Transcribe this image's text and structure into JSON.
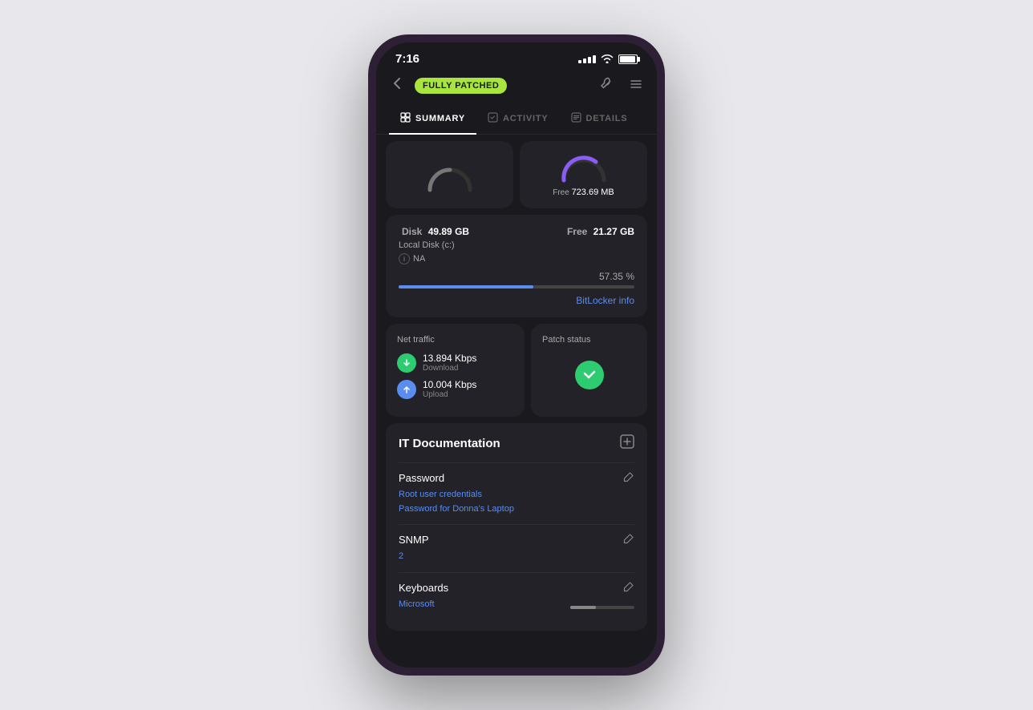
{
  "phone": {
    "status_bar": {
      "time": "7:16",
      "wifi": "wifi",
      "battery": "battery"
    },
    "header": {
      "back_icon": "←",
      "badge_label": "FULLY PATCHED",
      "tools_icon": "⚙",
      "menu_icon": "≡"
    },
    "tabs": [
      {
        "id": "summary",
        "icon": "⊞",
        "label": "SUMMARY",
        "active": true
      },
      {
        "id": "activity",
        "icon": "☑",
        "label": "ACTIVITY",
        "active": false
      },
      {
        "id": "details",
        "icon": "⊡",
        "label": "DETAILS",
        "active": false
      }
    ],
    "gauges": [
      {
        "id": "cpu",
        "arc_color": "#888",
        "free_label": "",
        "free_value": ""
      },
      {
        "id": "ram",
        "arc_color": "#8b5cf6",
        "free_label": "Free",
        "free_value": "723.69 MB"
      }
    ],
    "disk": {
      "label": "Disk",
      "total": "49.89 GB",
      "free_label": "Free",
      "free_value": "21.27 GB",
      "local_disk": "Local Disk (c:)",
      "na_label": "NA",
      "percent": "57.35 %",
      "progress_fill": 57,
      "bitlocker_link": "BitLocker info"
    },
    "net_traffic": {
      "title": "Net traffic",
      "download": {
        "speed": "13.894 Kbps",
        "label": "Download"
      },
      "upload": {
        "speed": "10.004 Kbps",
        "label": "Upload"
      }
    },
    "patch_status": {
      "title": "Patch status",
      "status": "ok"
    },
    "it_documentation": {
      "title": "IT Documentation",
      "add_icon": "+",
      "items": [
        {
          "name": "Password",
          "icon": "⚙",
          "links": [
            "Root user credentials",
            "Password for Donna's Laptop"
          ]
        },
        {
          "name": "SNMP",
          "icon": "⚙",
          "links": [
            "2"
          ]
        },
        {
          "name": "Keyboards",
          "icon": "⚙",
          "links": [
            "Microsoft"
          ]
        }
      ]
    }
  }
}
